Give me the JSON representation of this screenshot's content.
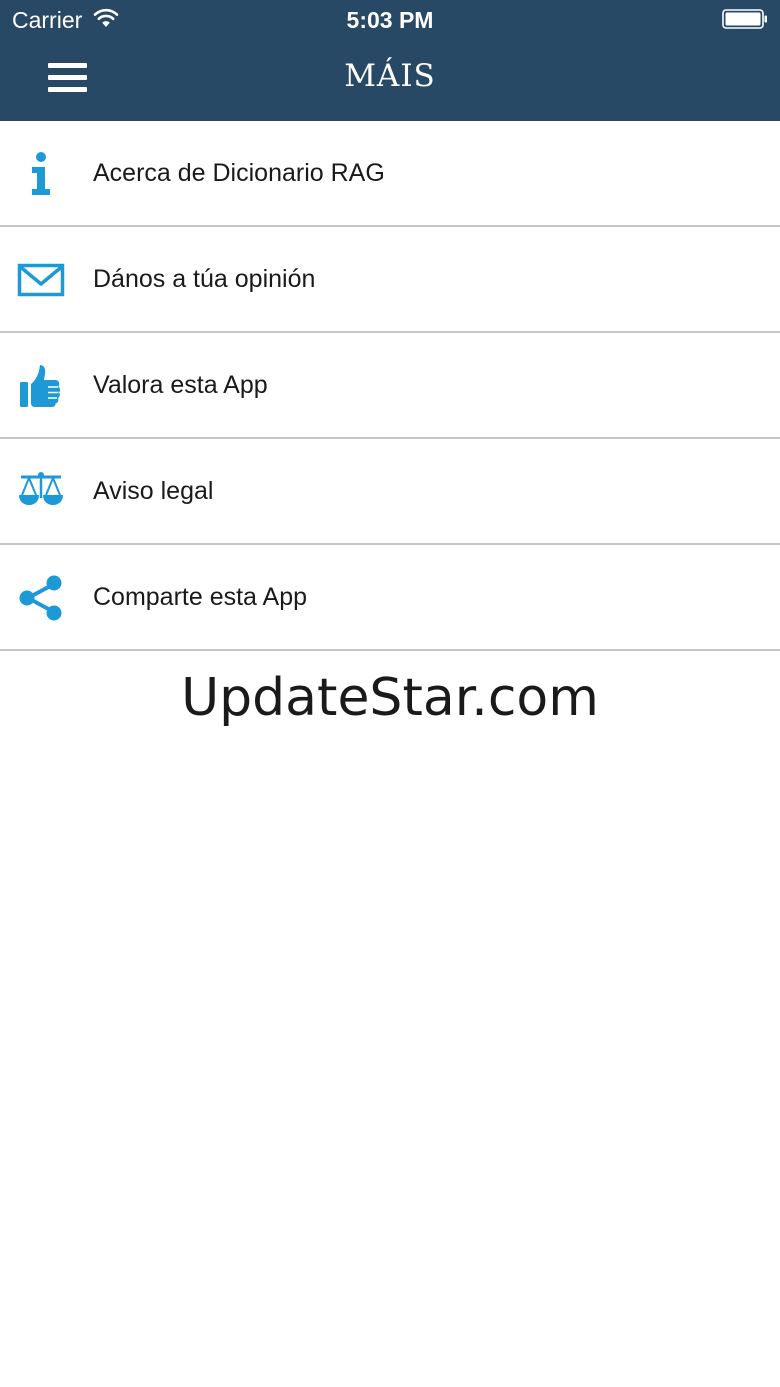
{
  "status_bar": {
    "carrier": "Carrier",
    "time": "5:03 PM"
  },
  "nav": {
    "title": "MÁIS",
    "menu_icon": "hamburger-icon"
  },
  "menu": {
    "items": [
      {
        "label": "Acerca de Dicionario RAG",
        "icon": "info-icon"
      },
      {
        "label": "Dános a túa opinión",
        "icon": "envelope-icon"
      },
      {
        "label": "Valora esta App",
        "icon": "thumbs-up-icon"
      },
      {
        "label": "Aviso legal",
        "icon": "scales-icon"
      },
      {
        "label": "Comparte esta App",
        "icon": "share-icon"
      }
    ]
  },
  "watermark": "UpdateStar.com",
  "colors": {
    "header_bg": "#284966",
    "icon": "#1c99d6",
    "divider": "#c7c7c7",
    "text": "#1a1a1a",
    "background": "#ffffff"
  }
}
